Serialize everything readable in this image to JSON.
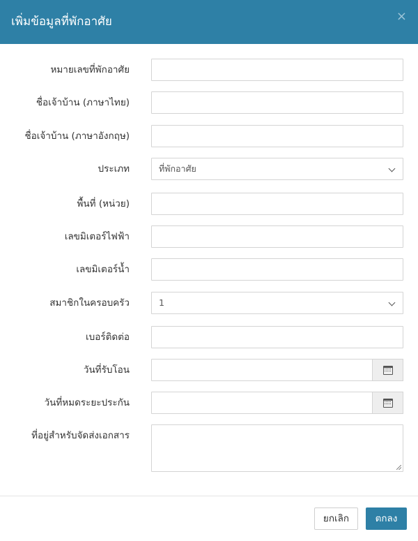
{
  "header": {
    "title": "เพิ่มข้อมูลที่พักอาศัย",
    "close_label": "×"
  },
  "fields": {
    "residence_number": {
      "label": "หมายเลขที่พักอาศัย",
      "value": ""
    },
    "owner_name_th": {
      "label": "ชื่อเจ้าบ้าน (ภาษาไทย)",
      "value": ""
    },
    "owner_name_en": {
      "label": "ชื่อเจ้าบ้าน (ภาษาอังกฤษ)",
      "value": ""
    },
    "type": {
      "label": "ประเภท",
      "selected": "ที่พักอาศัย"
    },
    "area": {
      "label": "พื้นที่ (หน่วย)",
      "value": ""
    },
    "electric_meter": {
      "label": "เลขมิเตอร์ไฟฟ้า",
      "value": ""
    },
    "water_meter": {
      "label": "เลขมิเตอร์น้ำ",
      "value": ""
    },
    "family_members": {
      "label": "สมาชิกในครอบครัว",
      "selected": "1"
    },
    "phone": {
      "label": "เบอร์ติดต่อ",
      "value": ""
    },
    "transfer_date": {
      "label": "วันที่รับโอน",
      "value": "",
      "icon": "calendar-icon"
    },
    "insurance_expiry": {
      "label": "วันที่หมดระยะประกัน",
      "value": "",
      "icon": "calendar-icon"
    },
    "mailing_address": {
      "label": "ที่อยู่สำหรับจัดส่งเอกสาร",
      "value": ""
    }
  },
  "footer": {
    "cancel_label": "ยกเลิก",
    "ok_label": "ตกลง"
  },
  "colors": {
    "header_bg": "#2e80a6",
    "primary_button": "#2e80a6"
  }
}
